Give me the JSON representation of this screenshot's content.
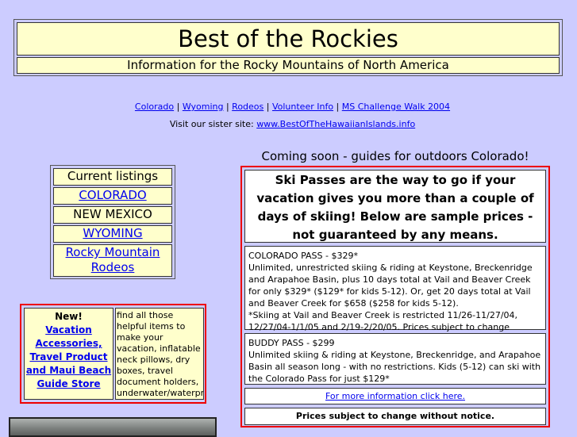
{
  "header": {
    "title": "Best of the Rockies",
    "subtitle": "Information for the Rocky Mountains of North America"
  },
  "nav": {
    "links": [
      "Colorado",
      "Wyoming",
      "Rodeos",
      "Volunteer Info",
      "MS Challenge Walk 2004"
    ],
    "separator": " | "
  },
  "sister": {
    "label": "Visit our sister site: ",
    "link": "www.BestOfTheHawaiianIslands.info"
  },
  "listings": {
    "heading": "Current listings",
    "colorado": "COLORADO",
    "new_mexico": "NEW MEXICO",
    "wyoming": "WYOMING",
    "rodeos": "Rocky Mountain Rodeos"
  },
  "newbox": {
    "new_label": "New!",
    "link": "Vacation Accessories, Travel Product and Maui Beach Guide Store",
    "description": "find all those helpful items to make your vacation, inflatable neck pillows, dry boxes, travel document holders, underwater/waterproof cameras and more."
  },
  "coming_soon": "Coming soon - guides for outdoors Colorado!",
  "ski": {
    "headline": "Ski Passes are the way to go if your vacation gives you more than a couple of days of skiing! Below are sample prices - not guaranteed by any means.",
    "colorado_pass_title": "COLORADO PASS - $329*",
    "colorado_pass_body": "Unlimited, unrestricted skiing & riding at Keystone, Breckenridge and Arapahoe Basin, plus 10 days total at Vail and Beaver Creek for only $329* ($129* for kids 5-12). Or, get 20 days total at Vail and Beaver Creek for $658 ($258 for kids 5-12).",
    "colorado_pass_note": "*Skiing at Vail and Beaver Creek is restricted 11/26-11/27/04, 12/27/04-1/1/05 and 2/19-2/20/05. Prices subject to change without notice.",
    "buddy_pass_title": "BUDDY PASS - $299",
    "buddy_pass_body": "Unlimited skiing & riding at Keystone, Breckenridge, and Arapahoe Basin all season long - with no restrictions. Kids (5-12) can ski with the Colorado Pass for just $129*",
    "more_info": "For more information click here.",
    "disclaimer": "Prices subject to change without notice."
  }
}
